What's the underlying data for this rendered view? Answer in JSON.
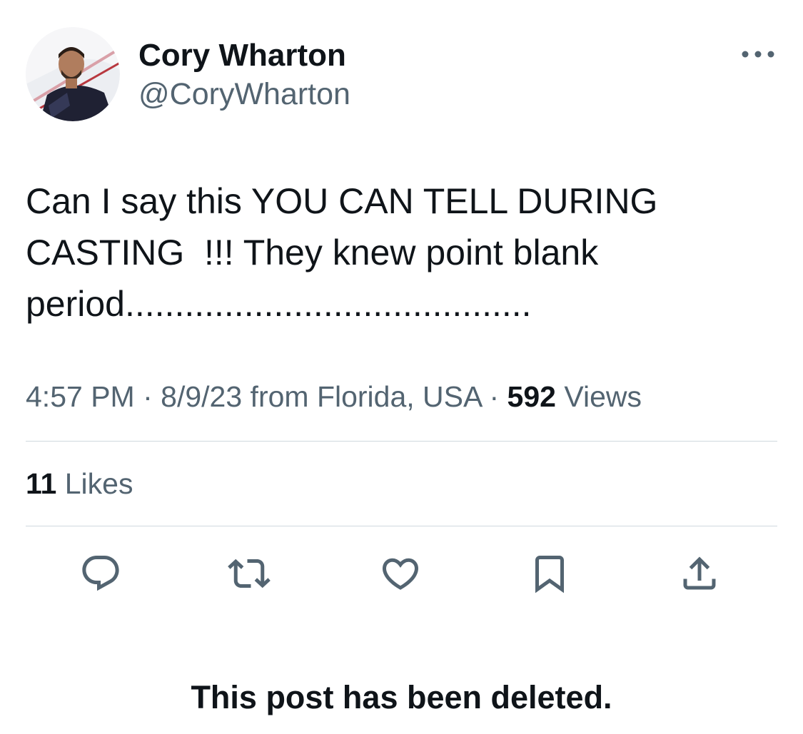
{
  "author": {
    "display_name": "Cory Wharton",
    "handle": "@CoryWharton"
  },
  "tweet": {
    "text": "Can I say this YOU CAN TELL DURING\nCASTING  !!! They knew point blank\nperiod.........................................",
    "time": "4:57 PM",
    "date": "8/9/23",
    "location": "from Florida, USA",
    "separator": " · ",
    "views_count": "592",
    "views_label": "Views",
    "likes_count": "11",
    "likes_label": "Likes"
  },
  "actions": {
    "reply_icon": "reply-icon",
    "retweet_icon": "retweet-icon",
    "like_icon": "heart-icon",
    "bookmark_icon": "bookmark-icon",
    "share_icon": "share-icon"
  },
  "notice": {
    "deleted": "This post has been deleted."
  },
  "colors": {
    "primary_text": "#0f1419",
    "secondary_text": "#536471",
    "divider": "#cfd9de",
    "icon": "#536471"
  }
}
